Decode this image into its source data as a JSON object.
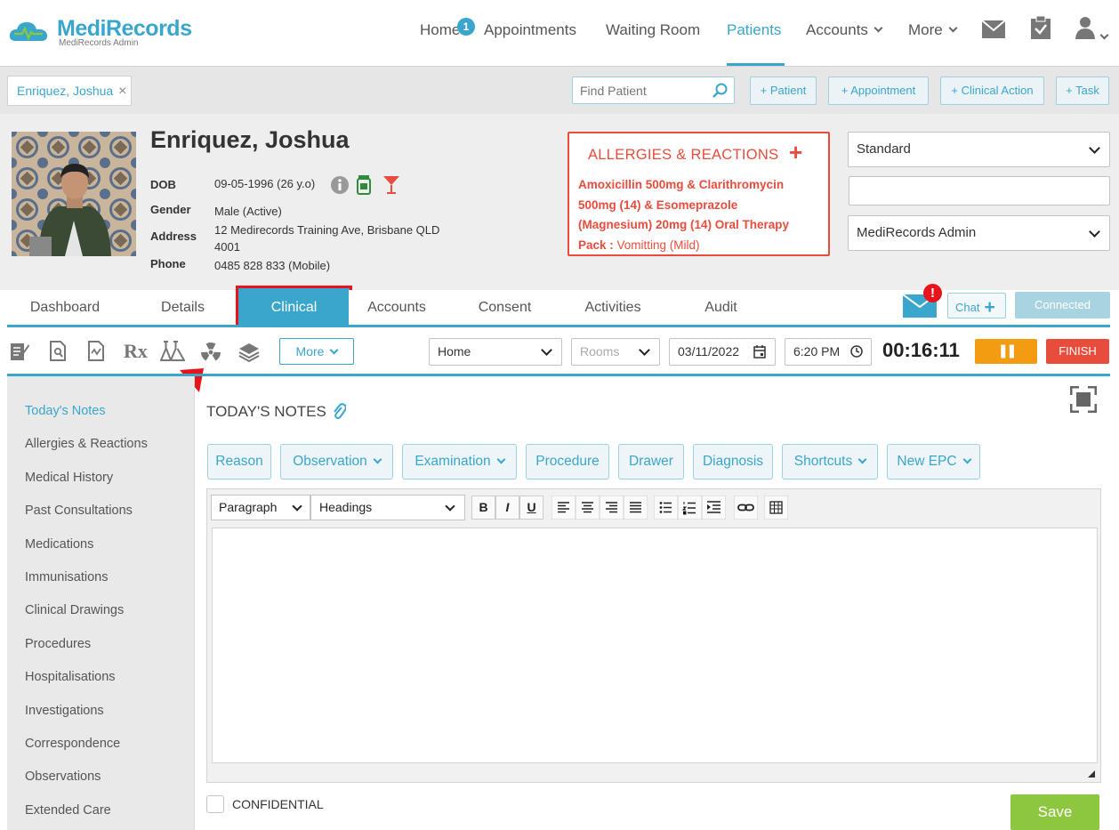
{
  "app": {
    "brand": "MediRecords",
    "brand_sub": "MediRecords Admin"
  },
  "nav": {
    "home": "Home",
    "home_badge": "1",
    "appointments": "Appointments",
    "waiting_room": "Waiting Room",
    "patients": "Patients",
    "accounts": "Accounts",
    "more": "More"
  },
  "patient_tab": {
    "label": "Enriquez, Joshua",
    "close": "×"
  },
  "search": {
    "placeholder": "Find Patient"
  },
  "quick_actions": {
    "patient": "+ Patient",
    "appointment": "+ Appointment",
    "clinical_action": "+ Clinical Action",
    "task": "+ Task"
  },
  "patient": {
    "name": "Enriquez, Joshua",
    "dob_label": "DOB",
    "dob": "09-05-1996 (26 y.o)",
    "gender_label": "Gender",
    "gender": "Male (Active)",
    "address_label": "Address",
    "address_line1": "12 Medirecords Training Ave, Brisbane QLD",
    "address_line2": "4001",
    "phone_label": "Phone",
    "phone": "0485 828 833 (Mobile)"
  },
  "allergies": {
    "title": "ALLERGIES & REACTIONS",
    "add": "+",
    "line1": "Amoxicillin 500mg & Clarithromycin",
    "line2": "500mg (14) & Esomeprazole",
    "line3": "(Magnesium) 20mg (14) Oral Therapy",
    "line4": "Pack",
    "reaction_sep": " : ",
    "reaction": "Vomitting (Mild)"
  },
  "right_selects": {
    "billing": "Standard",
    "blank": "",
    "provider": "MediRecords Admin"
  },
  "tabs": [
    "Dashboard",
    "Details",
    "Clinical",
    "Accounts",
    "Consent",
    "Activities",
    "Audit"
  ],
  "chat": {
    "label": "Chat",
    "plus": "+",
    "status": "Connected",
    "alert": "!"
  },
  "toolbar": {
    "more": "More",
    "location": "Home",
    "rooms": "Rooms",
    "date": "03/11/2022",
    "time": "6:20 PM",
    "timer": "00:16:11",
    "pause": "❚❚",
    "finish": "FINISH",
    "rx": "Rx"
  },
  "sidebar": [
    "Today's Notes",
    "Allergies & Reactions",
    "Medical History",
    "Past Consultations",
    "Medications",
    "Immunisations",
    "Clinical Drawings",
    "Procedures",
    "Hospitalisations",
    "Investigations",
    "Correspondence",
    "Observations",
    "Extended Care"
  ],
  "notes": {
    "title": "TODAY'S NOTES",
    "buttons": {
      "reason": "Reason",
      "observation": "Observation",
      "examination": "Examination",
      "procedure": "Procedure",
      "drawer": "Drawer",
      "diagnosis": "Diagnosis",
      "shortcuts": "Shortcuts",
      "new_epc": "New EPC"
    },
    "format": {
      "paragraph": "Paragraph",
      "headings": "Headings",
      "bold": "B",
      "italic": "I",
      "underline": "U"
    },
    "confidential": "CONFIDENTIAL",
    "save": "Save"
  },
  "colors": {
    "accent": "#3aa6cc",
    "alert": "#e74c3c",
    "pause": "#f39c12",
    "save": "#8dc63f",
    "connected": "#a8d4e2"
  }
}
